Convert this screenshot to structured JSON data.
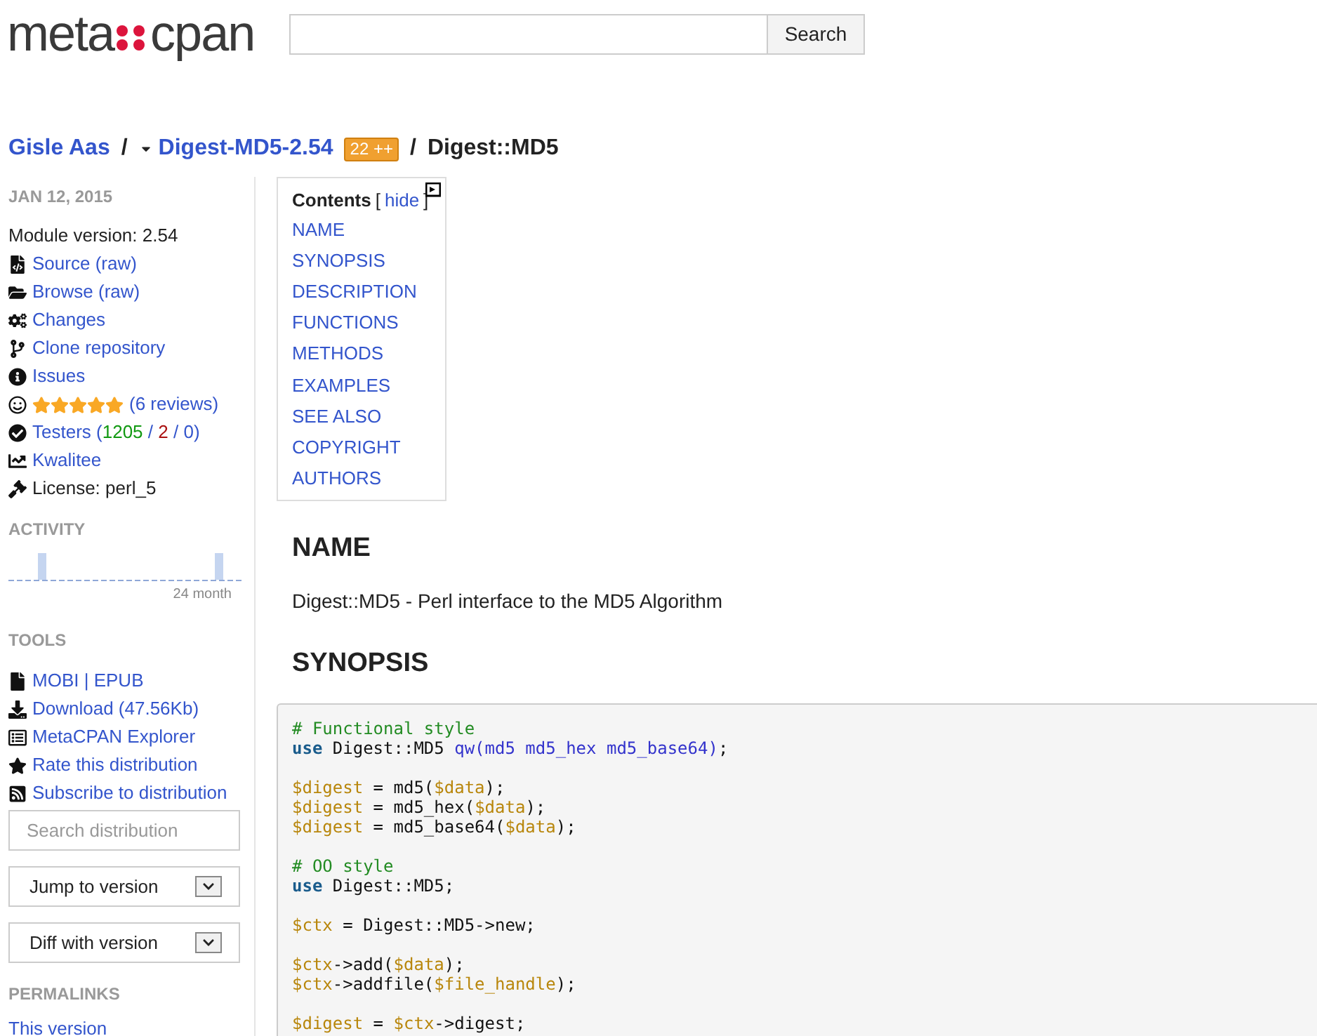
{
  "header": {
    "logo": {
      "left": "meta",
      "right": "cpan"
    },
    "search_button": "Search"
  },
  "breadcrumb": {
    "author": "Gisle Aas",
    "separator": "/",
    "release": "Digest-MD5-2.54",
    "badge": "22 ++",
    "module": "Digest::MD5"
  },
  "sidebar": {
    "date": "JAN 12, 2015",
    "version": "Module version: 2.54",
    "items": [
      {
        "kind": "source",
        "parts": [
          {
            "text": "Source",
            "kind": "link"
          },
          {
            "text": " (",
            "kind": "link"
          },
          {
            "text": "raw",
            "kind": "link"
          },
          {
            "text": ")",
            "kind": "link"
          }
        ]
      },
      {
        "kind": "browse",
        "parts": [
          {
            "text": "Browse",
            "kind": "link"
          },
          {
            "text": " (",
            "kind": "link"
          },
          {
            "text": "raw",
            "kind": "link"
          },
          {
            "text": ")",
            "kind": "link"
          }
        ]
      },
      {
        "kind": "changes",
        "parts": [
          {
            "text": "Changes",
            "kind": "link"
          }
        ]
      },
      {
        "kind": "clone",
        "parts": [
          {
            "text": "Clone repository",
            "kind": "link"
          }
        ]
      },
      {
        "kind": "issues",
        "parts": [
          {
            "text": "Issues",
            "kind": "link"
          }
        ]
      },
      {
        "kind": "rating",
        "stars": 5,
        "parts": [
          {
            "text": "(6 reviews)",
            "kind": "link"
          }
        ]
      },
      {
        "kind": "testers",
        "parts": [
          {
            "text": "Testers",
            "kind": "link"
          },
          {
            "text": " (",
            "kind": "link"
          },
          {
            "text": "1205",
            "kind": "pass"
          },
          {
            "text": " / ",
            "kind": "link"
          },
          {
            "text": "2",
            "kind": "fail"
          },
          {
            "text": " / ",
            "kind": "link"
          },
          {
            "text": "0",
            "kind": "link"
          },
          {
            "text": ")",
            "kind": "link"
          }
        ]
      },
      {
        "kind": "kwalitee",
        "parts": [
          {
            "text": "Kwalitee",
            "kind": "link"
          }
        ]
      },
      {
        "kind": "license",
        "parts": [
          {
            "text": "License: perl_5",
            "kind": "plain"
          }
        ]
      }
    ],
    "activity_title": "ACTIVITY",
    "activity_label": "24 month",
    "tools_title": "TOOLS",
    "tools": [
      {
        "kind": "file",
        "parts": [
          {
            "text": "MOBI",
            "kind": "link"
          },
          {
            "text": " | ",
            "kind": "link"
          },
          {
            "text": "EPUB",
            "kind": "link"
          }
        ]
      },
      {
        "kind": "download",
        "parts": [
          {
            "text": "Download (47.56Kb)",
            "kind": "link"
          }
        ]
      },
      {
        "kind": "explorer",
        "parts": [
          {
            "text": "MetaCPAN Explorer",
            "kind": "link"
          }
        ]
      },
      {
        "kind": "star",
        "parts": [
          {
            "text": "Rate this distribution",
            "kind": "link"
          }
        ]
      },
      {
        "kind": "rss",
        "parts": [
          {
            "text": "Subscribe to distribution",
            "kind": "link"
          }
        ]
      }
    ],
    "search": {
      "placeholder": "Search distribution"
    },
    "selects": [
      "Jump to version",
      "Diff with version"
    ],
    "permalinks_title": "PERMALINKS",
    "permalink": "This version"
  },
  "toc": {
    "title": "Contents",
    "open_bracket": "[",
    "hide": "hide",
    "close_bracket": "]",
    "items": [
      "NAME",
      "SYNOPSIS",
      "DESCRIPTION",
      "FUNCTIONS",
      "METHODS",
      "EXAMPLES",
      "SEE ALSO",
      "COPYRIGHT",
      "AUTHORS"
    ]
  },
  "content": [
    {
      "kind": "heading",
      "text": "NAME"
    },
    {
      "kind": "paragraph",
      "text": "Digest::MD5 - Perl interface to the MD5 Algorithm"
    },
    {
      "kind": "heading",
      "text": "SYNOPSIS"
    }
  ],
  "code": [
    {
      "lines": [
        [
          {
            "kind": "comment",
            "s": "# Functional style"
          }
        ],
        [
          {
            "kind": "keyword",
            "s": "use"
          },
          {
            "kind": "plain",
            "s": " Digest::MD5 "
          },
          {
            "kind": "qw",
            "s": "qw(md5 md5_hex md5_base64)"
          },
          {
            "kind": "plain",
            "s": ";"
          }
        ]
      ]
    },
    {
      "lines": [
        [
          {
            "kind": "var",
            "s": "$digest"
          },
          {
            "kind": "plain",
            "s": " = md5("
          },
          {
            "kind": "var",
            "s": "$data"
          },
          {
            "kind": "plain",
            "s": ");"
          }
        ],
        [
          {
            "kind": "var",
            "s": "$digest"
          },
          {
            "kind": "plain",
            "s": " = md5_hex("
          },
          {
            "kind": "var",
            "s": "$data"
          },
          {
            "kind": "plain",
            "s": ");"
          }
        ],
        [
          {
            "kind": "var",
            "s": "$digest"
          },
          {
            "kind": "plain",
            "s": " = md5_base64("
          },
          {
            "kind": "var",
            "s": "$data"
          },
          {
            "kind": "plain",
            "s": ");"
          }
        ]
      ]
    },
    {
      "lines": [
        [
          {
            "kind": "comment",
            "s": "# OO style"
          }
        ],
        [
          {
            "kind": "keyword",
            "s": "use"
          },
          {
            "kind": "plain",
            "s": " Digest::MD5;"
          }
        ]
      ]
    },
    {
      "lines": [
        [
          {
            "kind": "var",
            "s": "$ctx"
          },
          {
            "kind": "plain",
            "s": " = Digest::MD5->new;"
          }
        ]
      ]
    },
    {
      "lines": [
        [
          {
            "kind": "var",
            "s": "$ctx"
          },
          {
            "kind": "plain",
            "s": "->add("
          },
          {
            "kind": "var",
            "s": "$data"
          },
          {
            "kind": "plain",
            "s": ");"
          }
        ],
        [
          {
            "kind": "var",
            "s": "$ctx"
          },
          {
            "kind": "plain",
            "s": "->addfile("
          },
          {
            "kind": "var",
            "s": "$file_handle"
          },
          {
            "kind": "plain",
            "s": ");"
          }
        ]
      ]
    },
    {
      "lines": [
        [
          {
            "kind": "var",
            "s": "$digest"
          },
          {
            "kind": "plain",
            "s": " = "
          },
          {
            "kind": "var",
            "s": "$ctx"
          },
          {
            "kind": "plain",
            "s": "->digest;"
          }
        ]
      ]
    }
  ]
}
